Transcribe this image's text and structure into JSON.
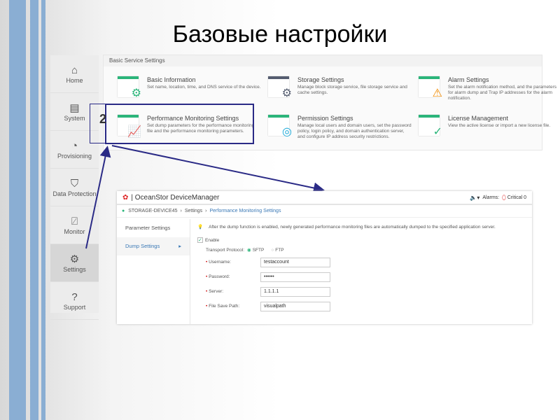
{
  "slide_title": "Базовые настройки",
  "sidebar": {
    "items": [
      {
        "label": "Home",
        "icon": "home-icon",
        "glyph": "⌂"
      },
      {
        "label": "System",
        "icon": "system-icon",
        "glyph": "▤"
      },
      {
        "label": "Provisioning",
        "icon": "provisioning-icon",
        "glyph": "◔"
      },
      {
        "label": "Data Protection",
        "icon": "shield-icon",
        "glyph": "⛉"
      },
      {
        "label": "Monitor",
        "icon": "monitor-icon",
        "glyph": "⍁"
      },
      {
        "label": "Settings",
        "icon": "gear-icon",
        "glyph": "⚙"
      },
      {
        "label": "Support",
        "icon": "help-icon",
        "glyph": "?"
      }
    ],
    "active": "Settings"
  },
  "panel": {
    "title": "Basic Service Settings",
    "cards": [
      {
        "title": "Basic Information",
        "desc": "Set name, location, time, and DNS service of the device."
      },
      {
        "title": "Storage Settings",
        "desc": "Manage block storage service, file storage service and cache settings."
      },
      {
        "title": "Alarm Settings",
        "desc": "Set the alarm notification method, and the parameters for alarm dump and Trap IP addresses for the alarm notification."
      },
      {
        "title": "Performance Monitoring Settings",
        "desc": "Set dump parameters for the performance monitoring file and the performance monitoring parameters."
      },
      {
        "title": "Permission Settings",
        "desc": "Manage local users and domain users, set the password policy, login policy, and domain authentication server, and configure IP address security restrictions."
      },
      {
        "title": "License Management",
        "desc": "View the active license or import a new license file."
      }
    ]
  },
  "callout_number": "2",
  "device_manager": {
    "app_title": "| OceanStor DeviceManager",
    "alarms_label": "Alarms:",
    "critical_label": "Critical 0",
    "breadcrumb": [
      "STORAGE-DEVICE45",
      "Settings",
      "Performance Monitoring Settings"
    ],
    "left_nav": [
      "Parameter Settings",
      "Dump Settings"
    ],
    "tip": "After the dump function is enabled, newly generated performance monitoring files are automatically dumped to the specified application server.",
    "enable_label": "Enable",
    "enable_checked": true,
    "protocol_label": "Transport Protocol:",
    "protocol_options": [
      "SFTP",
      "FTP"
    ],
    "protocol_selected": "SFTP",
    "fields": [
      {
        "label": "Username:",
        "value": "testaccount"
      },
      {
        "label": "Password:",
        "value": "••••••"
      },
      {
        "label": "Server:",
        "value": "1.1.1.1"
      },
      {
        "label": "File Save Path:",
        "value": "visualpath"
      }
    ]
  },
  "colors": {
    "stripe": "#8aaed3",
    "annotation": "#2a2a86",
    "link": "#3a78b5",
    "green": "#2bb57a"
  }
}
